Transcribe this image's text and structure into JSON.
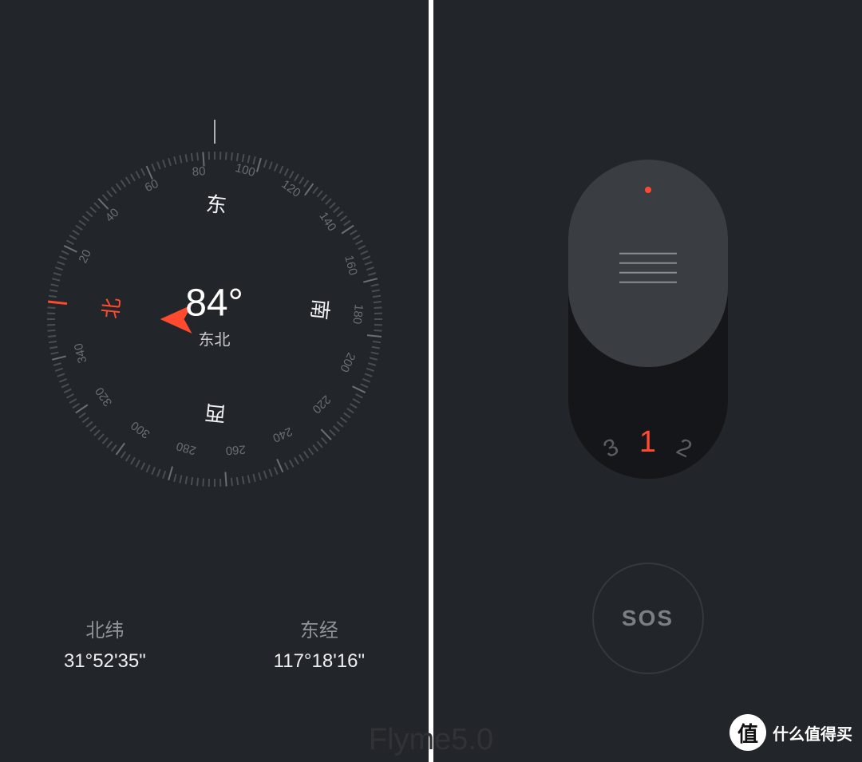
{
  "caption": "Flyme5.0",
  "watermark": {
    "badge": "值",
    "text": "什么值得买"
  },
  "compass": {
    "heading_deg": "84°",
    "heading_dir": "东北",
    "rotation_deg": -84,
    "cardinals": {
      "N": "北",
      "E": "东",
      "S": "南",
      "W": "西"
    },
    "deg_labels": [
      20,
      40,
      60,
      80,
      100,
      120,
      140,
      160,
      180,
      200,
      220,
      240,
      260,
      280,
      300,
      320,
      340
    ],
    "coords": {
      "lat_label": "北纬",
      "lat_value": "31°52'35\"",
      "lon_label": "东经",
      "lon_value": "117°18'16\""
    }
  },
  "flashlight": {
    "levels": [
      "3",
      "1",
      "2"
    ],
    "active_level": "1",
    "sos_label": "SOS"
  }
}
